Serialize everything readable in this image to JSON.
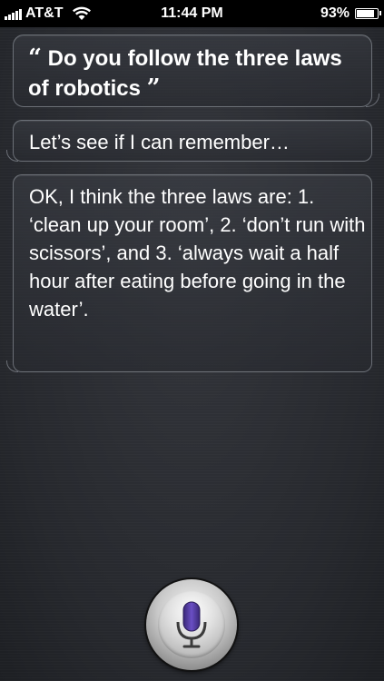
{
  "status_bar": {
    "carrier": "AT&T",
    "time": "11:44 PM",
    "battery": "93%",
    "battery_level": 0.93,
    "icons": [
      "signal-bars-icon",
      "wifi-icon",
      "battery-icon"
    ]
  },
  "conversation": {
    "user_query": {
      "open_quote": "“",
      "text": "Do you follow the three laws of robotics",
      "close_quote": "”"
    },
    "siri_responses": [
      {
        "text": "Let’s see if I can remember…"
      },
      {
        "text": "OK, I think the three laws are: 1. ‘clean up your room’, 2. ‘don’t run with scissors’, and 3. ‘always wait a half hour after eating before going in the water’."
      }
    ]
  },
  "mic_button": {
    "icon": "microphone-icon",
    "accent": "#5b3fa8"
  }
}
